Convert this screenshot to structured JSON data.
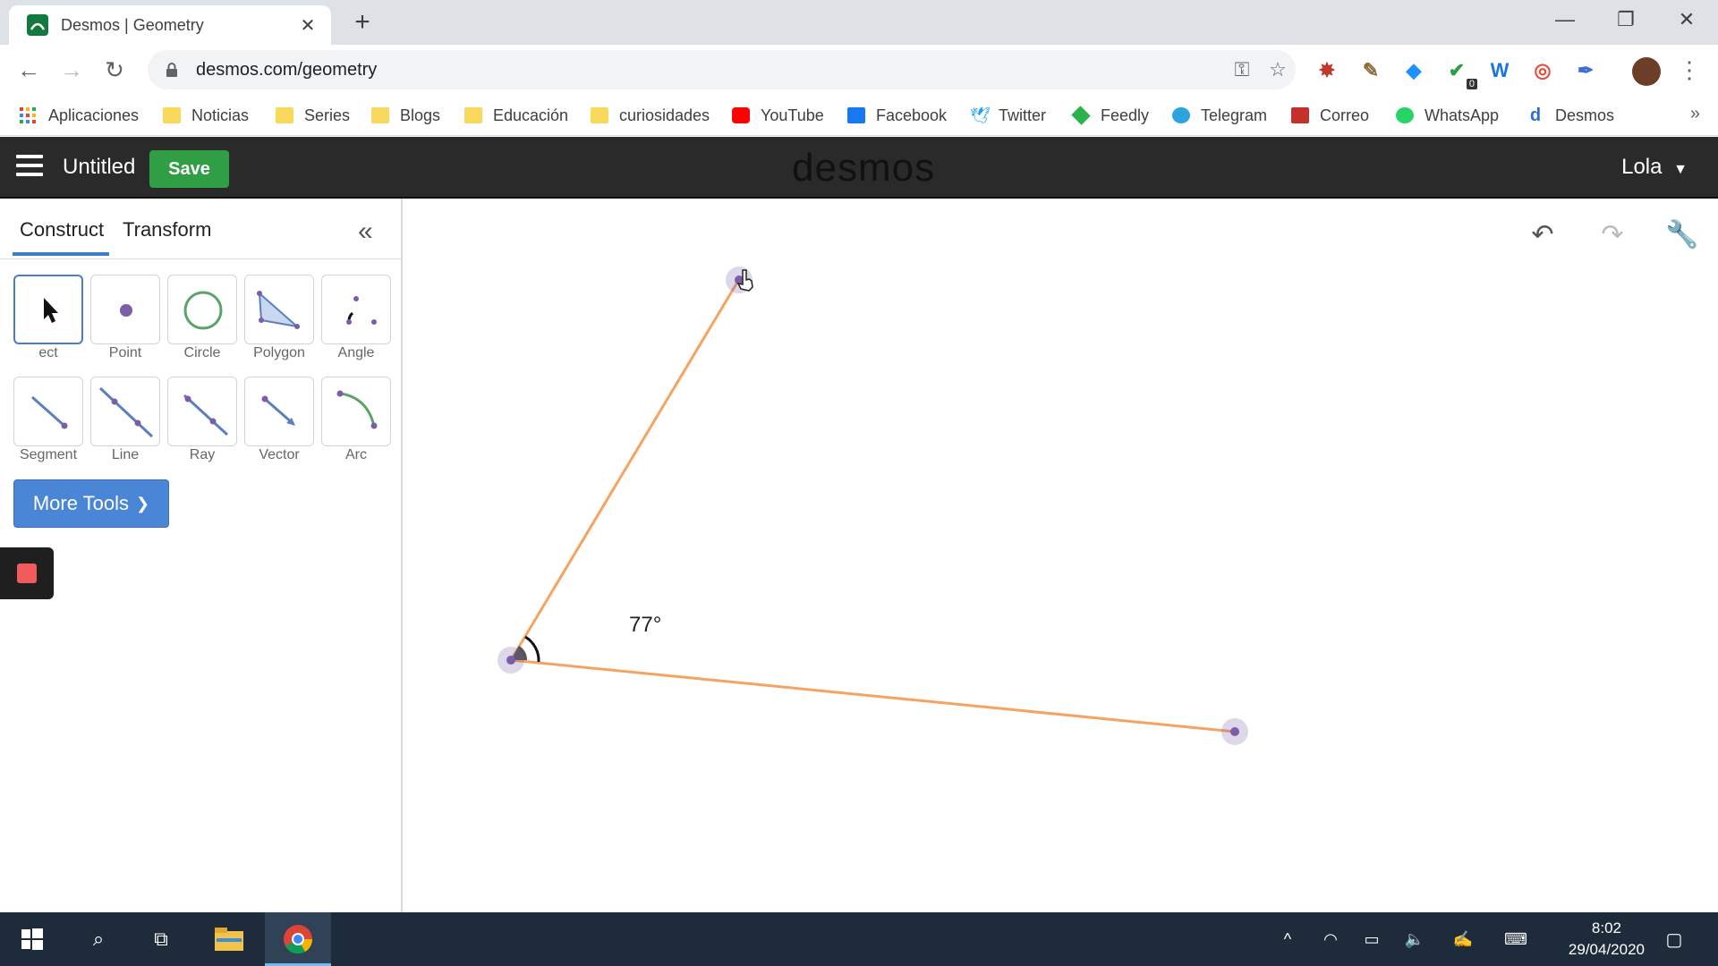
{
  "browser": {
    "tab_title": "Desmos | Geometry",
    "url": "desmos.com/geometry",
    "ext_badge": "0",
    "bookmarks": [
      {
        "label": "Aplicaciones",
        "icon": "apps-grid-icon"
      },
      {
        "label": "Noticias",
        "icon": "folder-icon"
      },
      {
        "label": "Series",
        "icon": "folder-icon"
      },
      {
        "label": "Blogs",
        "icon": "folder-icon"
      },
      {
        "label": "Educación",
        "icon": "folder-icon"
      },
      {
        "label": "curiosidades",
        "icon": "folder-icon"
      },
      {
        "label": "YouTube",
        "icon": "youtube-icon"
      },
      {
        "label": "Facebook",
        "icon": "facebook-icon"
      },
      {
        "label": "Twitter",
        "icon": "twitter-icon"
      },
      {
        "label": "Feedly",
        "icon": "feedly-icon"
      },
      {
        "label": "Telegram",
        "icon": "telegram-icon"
      },
      {
        "label": "Correo",
        "icon": "mail-icon"
      },
      {
        "label": "WhatsApp",
        "icon": "whatsapp-icon"
      },
      {
        "label": "Desmos",
        "icon": "desmos-icon"
      }
    ]
  },
  "app": {
    "doc_title": "Untitled",
    "save_label": "Save",
    "logo": "desmos",
    "user": "Lola"
  },
  "panel": {
    "tabs": [
      "Construct",
      "Transform"
    ],
    "tools_row1": [
      "ect",
      "Point",
      "Circle",
      "Polygon",
      "Angle"
    ],
    "tools_row2": [
      "Segment",
      "Line",
      "Ray",
      "Vector",
      "Arc"
    ],
    "more_tools": "More Tools"
  },
  "canvas": {
    "angle_label": "77°",
    "segment_color": "#f4a460",
    "point_color": "#7b5ea7"
  },
  "taskbar": {
    "time": "8:02",
    "date": "29/04/2020"
  }
}
